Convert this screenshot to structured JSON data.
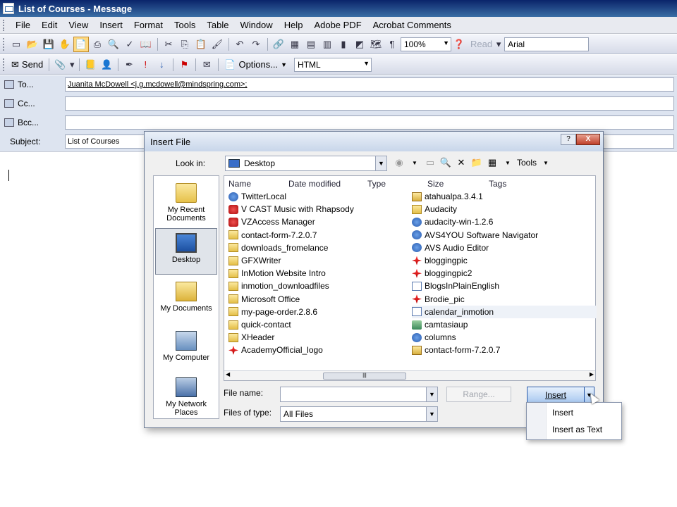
{
  "window": {
    "title": "List of Courses - Message"
  },
  "menu": [
    "File",
    "Edit",
    "View",
    "Insert",
    "Format",
    "Tools",
    "Table",
    "Window",
    "Help",
    "Adobe PDF",
    "Acrobat Comments"
  ],
  "toolbar1": {
    "zoom": "100%",
    "read_label": "Read",
    "font": "Arial"
  },
  "toolbar2": {
    "send_label": "Send",
    "options_label": "Options...",
    "format": "HTML"
  },
  "header": {
    "to_label": "To...",
    "to_value": "Juanita McDowell <j.g.mcdowell@mindspring.com>;",
    "cc_label": "Cc...",
    "cc_value": "",
    "bcc_label": "Bcc...",
    "bcc_value": "",
    "subject_label": "Subject:",
    "subject_value": "List of Courses"
  },
  "dialog": {
    "title": "Insert File",
    "help": "?",
    "close": "X",
    "look_in_label": "Look in:",
    "look_in_value": "Desktop",
    "tools_label": "Tools",
    "places": [
      "My Recent Documents",
      "Desktop",
      "My Documents",
      "My Computer",
      "My Network Places"
    ],
    "columns": [
      "Name",
      "Date modified",
      "Type",
      "Size",
      "Tags"
    ],
    "files_left": [
      {
        "name": "TwitterLocal",
        "icon": "app"
      },
      {
        "name": "V CAST Music with Rhapsody",
        "icon": "red"
      },
      {
        "name": "VZAccess Manager",
        "icon": "red"
      },
      {
        "name": "contact-form-7.2.0.7",
        "icon": "folder"
      },
      {
        "name": "downloads_fromelance",
        "icon": "folder"
      },
      {
        "name": "GFXWriter",
        "icon": "folder"
      },
      {
        "name": "InMotion Website Intro",
        "icon": "folder"
      },
      {
        "name": "inmotion_downloadfiles",
        "icon": "folder"
      },
      {
        "name": "Microsoft Office",
        "icon": "folder"
      },
      {
        "name": "my-page-order.2.8.6",
        "icon": "folder"
      },
      {
        "name": "quick-contact",
        "icon": "folder"
      },
      {
        "name": "XHeader",
        "icon": "folder"
      },
      {
        "name": "AcademyOfficial_logo",
        "icon": "pic"
      }
    ],
    "files_right": [
      {
        "name": "atahualpa.3.4.1",
        "icon": "zip"
      },
      {
        "name": "Audacity",
        "icon": "folder"
      },
      {
        "name": "audacity-win-1.2.6",
        "icon": "app"
      },
      {
        "name": "AVS4YOU Software Navigator",
        "icon": "app"
      },
      {
        "name": "AVS Audio Editor",
        "icon": "app"
      },
      {
        "name": "bloggingpic",
        "icon": "pic"
      },
      {
        "name": "bloggingpic2",
        "icon": "pic"
      },
      {
        "name": "BlogsInPlainEnglish",
        "icon": "doc"
      },
      {
        "name": "Brodie_pic",
        "icon": "pic"
      },
      {
        "name": "calendar_inmotion",
        "icon": "doc"
      },
      {
        "name": "camtasiaup",
        "icon": "cam"
      },
      {
        "name": "columns",
        "icon": "app"
      },
      {
        "name": "contact-form-7.2.0.7",
        "icon": "zip"
      }
    ],
    "file_name_label": "File name:",
    "file_name_value": "",
    "files_of_type_label": "Files of type:",
    "files_of_type_value": "All Files",
    "range_label": "Range...",
    "insert_label": "Insert",
    "menu_items": [
      "Insert",
      "Insert as Text"
    ]
  }
}
